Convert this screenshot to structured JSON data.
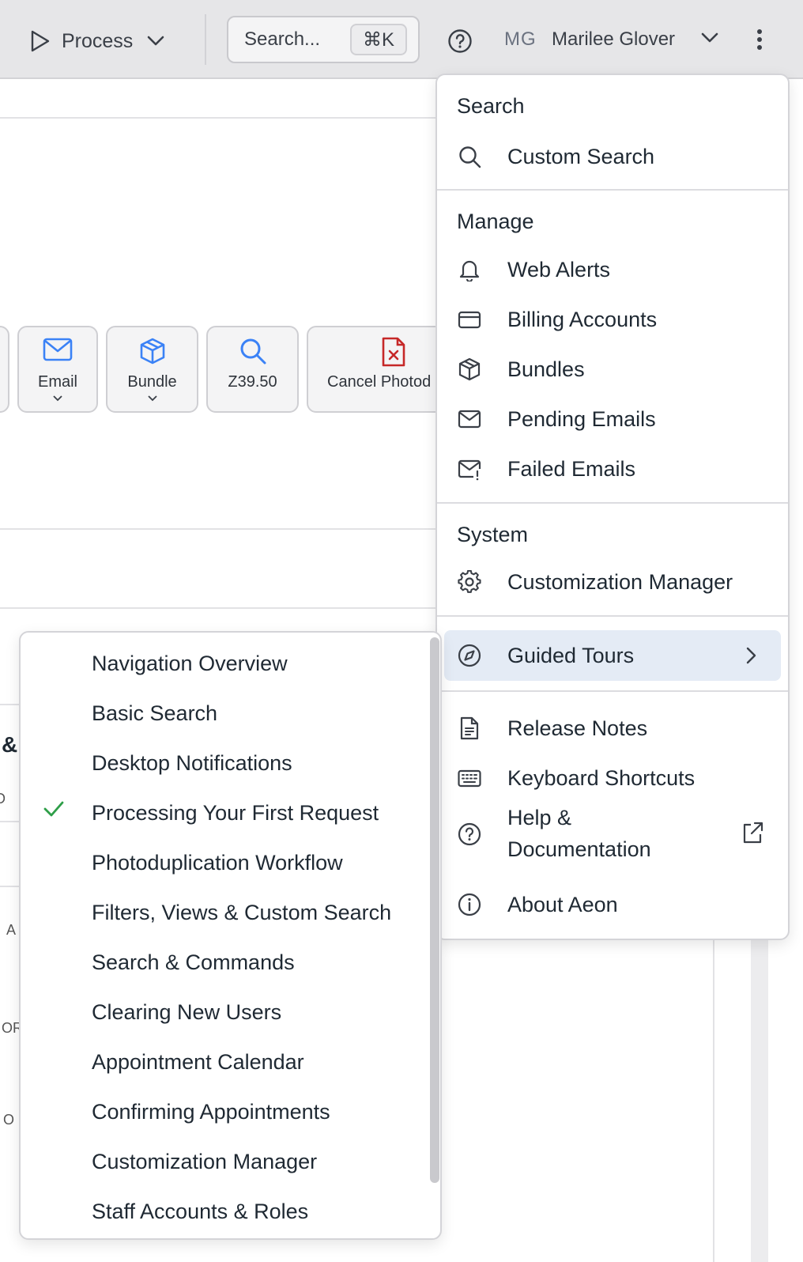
{
  "topbar": {
    "process_label": "Process",
    "search_label": "Search...",
    "search_shortcut": "⌘K",
    "user_initials": "MG",
    "user_name": "Marilee Glover"
  },
  "toolbar_tiles": [
    {
      "label": "Email",
      "icon": "envelope-icon"
    },
    {
      "label": "Bundle",
      "icon": "package-icon"
    },
    {
      "label": "Z39.50",
      "icon": "search-icon"
    },
    {
      "label": "Cancel Photod",
      "icon": "file-x-icon"
    }
  ],
  "background_fragments": {
    "ampersand": "&",
    "d": "D",
    "a": "A",
    "or": "OR",
    "o": "O"
  },
  "menu": {
    "search_heading": "Search",
    "custom_search": "Custom Search",
    "manage_heading": "Manage",
    "web_alerts": "Web Alerts",
    "billing_accounts": "Billing Accounts",
    "bundles": "Bundles",
    "pending_emails": "Pending Emails",
    "failed_emails": "Failed Emails",
    "system_heading": "System",
    "customization_manager": "Customization Manager",
    "guided_tours": "Guided Tours",
    "release_notes": "Release Notes",
    "keyboard_shortcuts": "Keyboard Shortcuts",
    "help_line1": "Help &",
    "help_line2": "Documentation",
    "about": "About Aeon"
  },
  "guided_tours": {
    "items": [
      "Navigation Overview",
      "Basic Search",
      "Desktop Notifications",
      "Processing Your First Request",
      "Photoduplication Workflow",
      "Filters, Views & Custom Search",
      "Search & Commands",
      "Clearing New Users",
      "Appointment Calendar",
      "Confirming Appointments",
      "Customization Manager",
      "Staff Accounts & Roles"
    ],
    "checked_item": "Processing Your First Request"
  },
  "colors": {
    "accent_blue": "#3b82f6",
    "danger_red": "#c62828",
    "check_green": "#2e9e48",
    "active_bg": "#e4ebf5"
  }
}
